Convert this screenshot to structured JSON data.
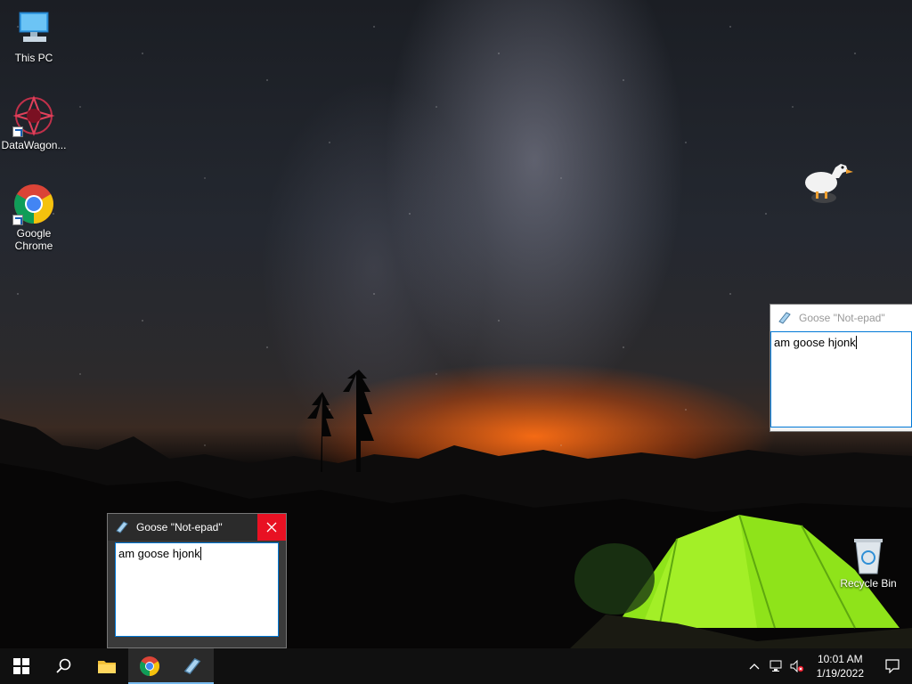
{
  "desktop": {
    "icons": [
      {
        "label": "This PC",
        "icon": "computer-icon"
      },
      {
        "label": "DataWagon...",
        "icon": "datawagon-icon"
      },
      {
        "label": "Google Chrome",
        "icon": "chrome-icon"
      },
      {
        "label": "Recycle Bin",
        "icon": "recycle-bin-icon"
      }
    ]
  },
  "windows": [
    {
      "title": "Goose \"Not-epad\"",
      "text": "am goose hjonk",
      "active": false
    },
    {
      "title": "Goose \"Not-epad\"",
      "text": "am goose hjonk",
      "active": true
    }
  ],
  "taskbar": {
    "items": [
      {
        "icon": "windows-start-icon"
      },
      {
        "icon": "search-icon"
      },
      {
        "icon": "file-explorer-icon"
      },
      {
        "icon": "chrome-icon",
        "active": true
      },
      {
        "icon": "notepad-icon",
        "active": true
      }
    ],
    "tray": {
      "time": "10:01 AM",
      "date": "1/19/2022",
      "icons": [
        "chevron-up-icon",
        "network-icon",
        "volume-muted-icon",
        "notification-icon"
      ]
    }
  },
  "colors": {
    "taskbar_bg": "#101010",
    "close_red": "#e81123",
    "accent": "#0078d7",
    "tent_green": "#8fe31a"
  }
}
